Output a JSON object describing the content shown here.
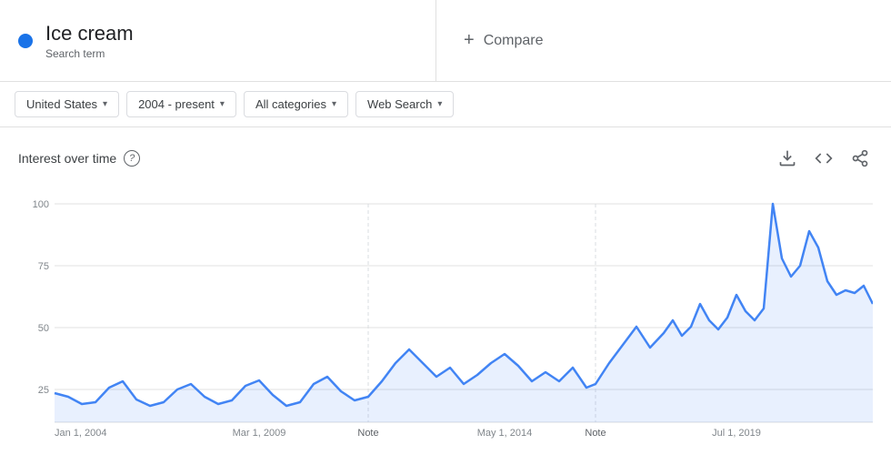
{
  "topBar": {
    "searchTerm": {
      "name": "Ice cream",
      "label": "Search term",
      "dotColor": "#1a73e8"
    },
    "compare": {
      "plusSign": "+",
      "label": "Compare"
    }
  },
  "filterBar": {
    "filters": [
      {
        "id": "region",
        "label": "United States"
      },
      {
        "id": "period",
        "label": "2004 - present"
      },
      {
        "id": "category",
        "label": "All categories"
      },
      {
        "id": "searchType",
        "label": "Web Search"
      }
    ]
  },
  "chart": {
    "title": "Interest over time",
    "helpIcon": "?",
    "downloadIcon": "↓",
    "embedIcon": "<>",
    "shareIcon": "⊲",
    "yLabels": [
      "100",
      "75",
      "50",
      "25"
    ],
    "xLabels": [
      "Jan 1, 2004",
      "Mar 1, 2009",
      "May 1, 2014",
      "Jul 1, 2019"
    ],
    "notes": [
      {
        "label": "Note",
        "xPercent": 40
      },
      {
        "label": "Note",
        "xPercent": 67
      }
    ]
  }
}
